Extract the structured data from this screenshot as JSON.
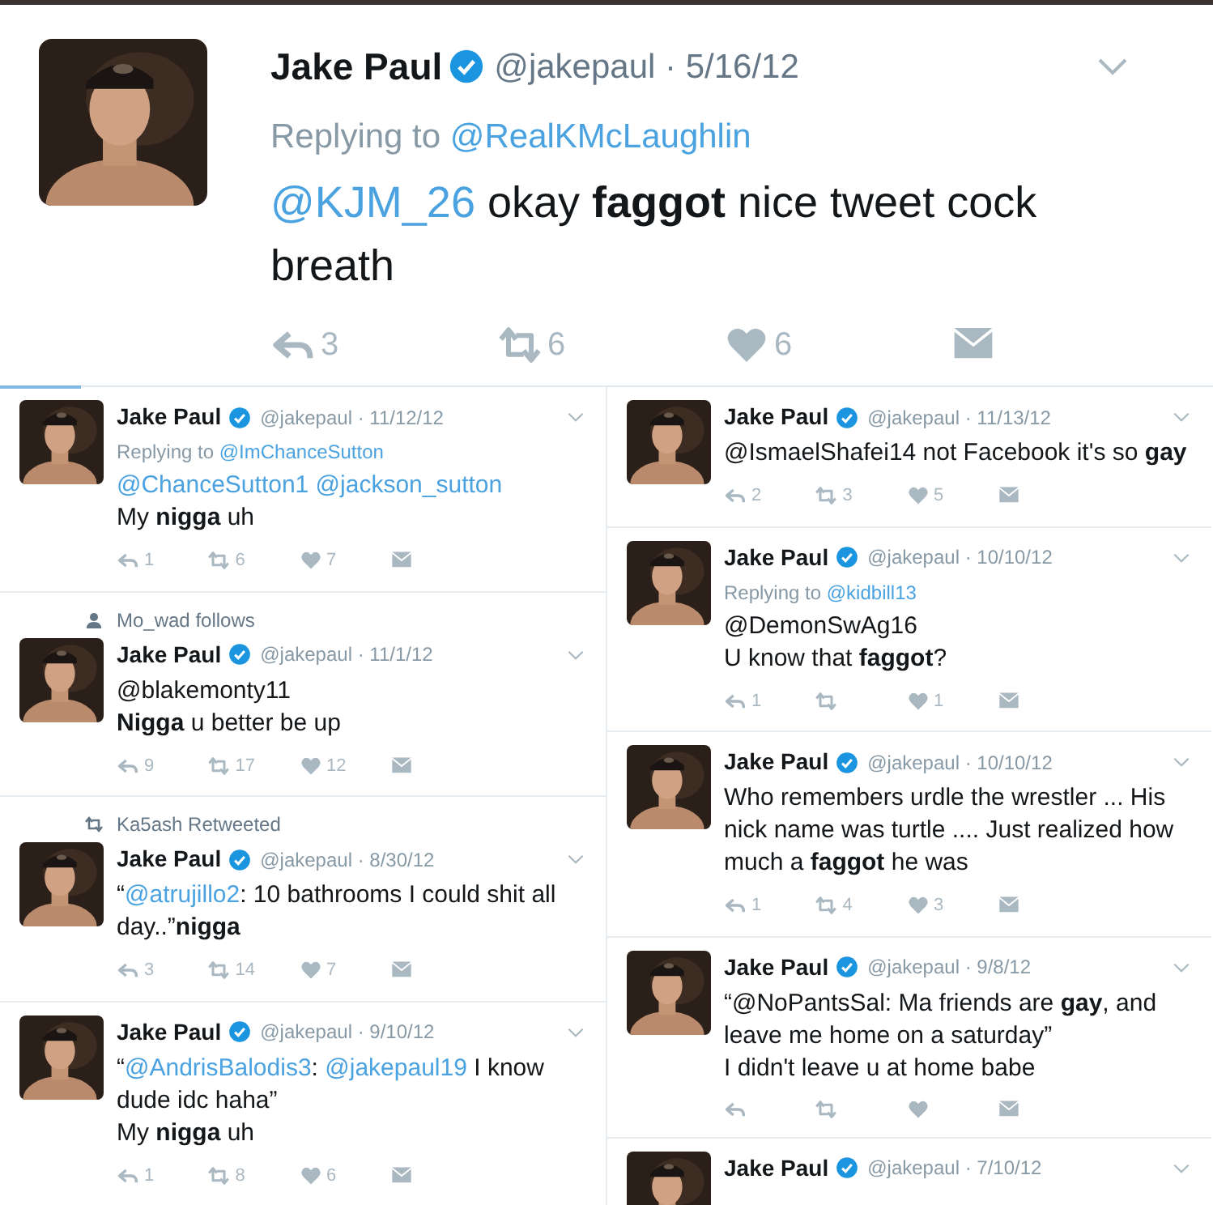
{
  "main_tweet": {
    "name": "Jake Paul",
    "handle_date": "@jakepaul · 5/16/12",
    "reply_label": "Replying to",
    "reply_mention": "@RealKMcLaughlin",
    "body": [
      [
        {
          "kind": "mention",
          "text": "@KJM_26"
        },
        {
          "kind": "text",
          "text": " okay **faggot** nice tweet cock breath"
        }
      ]
    ],
    "action_bar": true,
    "reply_count": "3",
    "retweet_count": "6",
    "like_count": "6"
  },
  "columns": [
    {
      "tweets": [
        {
          "name": "Jake Paul",
          "handle_date": "@jakepaul · 11/12/12",
          "reply_label": "Replying to",
          "reply_mention": "@ImChanceSutton",
          "body": [
            [
              {
                "kind": "mention",
                "text": "@ChanceSutton1 @jackson_sutton"
              }
            ],
            [
              {
                "kind": "text",
                "text": "My **nigga** uh"
              }
            ]
          ],
          "action_bar": true,
          "reply_count": "1",
          "retweet_count": "6",
          "like_count": "7"
        },
        {
          "context": {
            "kind": "follows",
            "text": "Mo_wad follows"
          },
          "name": "Jake Paul",
          "handle_date": "@jakepaul · 11/1/12",
          "body": [
            [
              {
                "kind": "text",
                "text": "@blakemonty11"
              }
            ],
            [
              {
                "kind": "text",
                "text": "**Nigga** u better be up"
              }
            ]
          ],
          "action_bar": true,
          "reply_count": "9",
          "retweet_count": "17",
          "like_count": "12"
        },
        {
          "context": {
            "kind": "retweeted",
            "text": "Ka5ash Retweeted"
          },
          "name": "Jake Paul",
          "handle_date": "@jakepaul · 8/30/12",
          "body": [
            [
              {
                "kind": "text",
                "text": "“"
              },
              {
                "kind": "mention",
                "text": "@atrujillo2"
              },
              {
                "kind": "text",
                "text": ": 10 bathrooms I could shit all day..”**nigga**"
              }
            ]
          ],
          "action_bar": true,
          "reply_count": "3",
          "retweet_count": "14",
          "like_count": "7"
        },
        {
          "name": "Jake Paul",
          "handle_date": "@jakepaul · 9/10/12",
          "body": [
            [
              {
                "kind": "text",
                "text": "“"
              },
              {
                "kind": "mention",
                "text": "@AndrisBalodis3"
              },
              {
                "kind": "text",
                "text": ": "
              },
              {
                "kind": "mention",
                "text": "@jakepaul19"
              },
              {
                "kind": "text",
                "text": " I know dude idc haha”"
              }
            ],
            [
              {
                "kind": "text",
                "text": "My **nigga** uh"
              }
            ]
          ],
          "action_bar": true,
          "reply_count": "1",
          "retweet_count": "8",
          "like_count": "6"
        }
      ]
    },
    {
      "tweets": [
        {
          "name": "Jake Paul",
          "handle_date": "@jakepaul · 11/13/12",
          "body": [
            [
              {
                "kind": "text",
                "text": "@IsmaelShafei14 not Facebook it's so **gay**"
              }
            ]
          ],
          "action_bar": true,
          "reply_count": "2",
          "retweet_count": "3",
          "like_count": "5"
        },
        {
          "name": "Jake Paul",
          "handle_date": "@jakepaul · 10/10/12",
          "reply_label": "Replying to",
          "reply_mention": "@kidbill13",
          "body": [
            [
              {
                "kind": "text",
                "text": "@DemonSwAg16"
              }
            ],
            [
              {
                "kind": "text",
                "text": "U know that **faggot**?"
              }
            ]
          ],
          "action_bar": true,
          "reply_count": "1",
          "like_count": "1"
        },
        {
          "name": "Jake Paul",
          "handle_date": "@jakepaul · 10/10/12",
          "body": [
            [
              {
                "kind": "text",
                "text": "Who remembers urdle the wrestler ... His nick name was turtle .... Just realized how much a **faggot** he was"
              }
            ]
          ],
          "action_bar": true,
          "reply_count": "1",
          "retweet_count": "4",
          "like_count": "3"
        },
        {
          "name": "Jake Paul",
          "handle_date": "@jakepaul · 9/8/12",
          "body": [
            [
              {
                "kind": "text",
                "text": "“@NoPantsSal: Ma friends are **gay**, and leave me home on a saturday”"
              }
            ],
            [
              {
                "kind": "text",
                "text": "I didn't leave u at home babe"
              }
            ]
          ],
          "action_bar": true
        },
        {
          "name": "Jake Paul",
          "handle_date": "@jakepaul · 7/10/12"
        }
      ]
    }
  ]
}
